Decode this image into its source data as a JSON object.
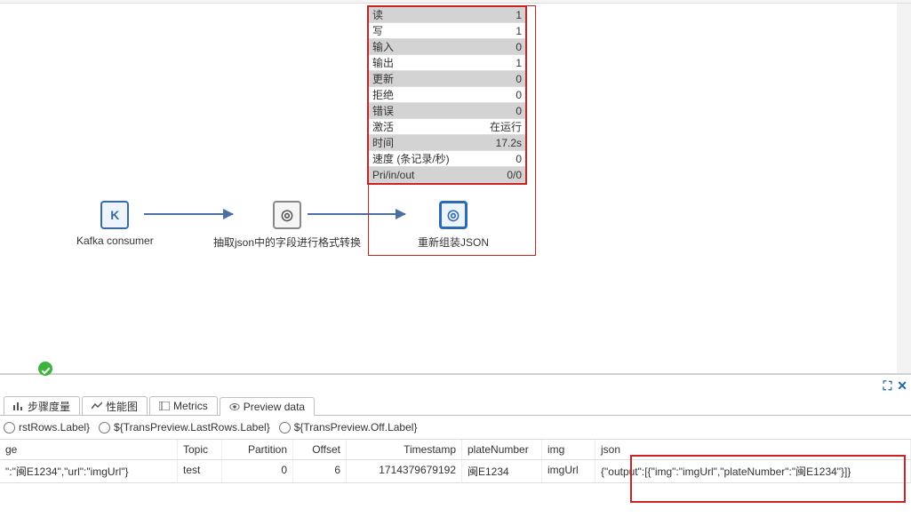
{
  "stats": [
    {
      "label": "读",
      "value": "1"
    },
    {
      "label": "写",
      "value": "1"
    },
    {
      "label": "输入",
      "value": "0"
    },
    {
      "label": "输出",
      "value": "1"
    },
    {
      "label": "更新",
      "value": "0"
    },
    {
      "label": "拒绝",
      "value": "0"
    },
    {
      "label": "错误",
      "value": "0"
    },
    {
      "label": "激活",
      "value": "在运行"
    },
    {
      "label": "时间",
      "value": "17.2s"
    },
    {
      "label": "速度 (条记录/秒)",
      "value": "0"
    },
    {
      "label": "Pri/in/out",
      "value": "0/0"
    }
  ],
  "nodes": {
    "n1": {
      "label": "Kafka consumer",
      "glyph": "K"
    },
    "n2": {
      "label": "抽取json中的字段进行格式转换",
      "glyph": "◎"
    },
    "n3": {
      "label": "重新组装JSON",
      "glyph": "◎"
    }
  },
  "tabs": {
    "t1": "步骤度量",
    "t2": "性能图",
    "t3": "Metrics",
    "t4": "Preview data"
  },
  "options": {
    "o1": "rstRows.Label}",
    "o2": "${TransPreview.LastRows.Label}",
    "o3": "${TransPreview.Off.Label}"
  },
  "grid": {
    "headers": {
      "c0": "ge",
      "c1": "Topic",
      "c2": "Partition",
      "c3": "Offset",
      "c4": "Timestamp",
      "c5": "plateNumber",
      "c6": "img",
      "c7": "json"
    },
    "row": {
      "c0": "\":\"闽E1234\",\"url\":\"imgUrl\"}",
      "c1": "test",
      "c2": "0",
      "c3": "6",
      "c4": "1714379679192",
      "c5": "闽E1234",
      "c6": "imgUrl",
      "c7": "{\"output\":[{\"img\":\"imgUrl\",\"plateNumber\":\"闽E1234\"}]}"
    }
  },
  "popout_icons": {
    "max": "⛶",
    "close": "✕"
  }
}
